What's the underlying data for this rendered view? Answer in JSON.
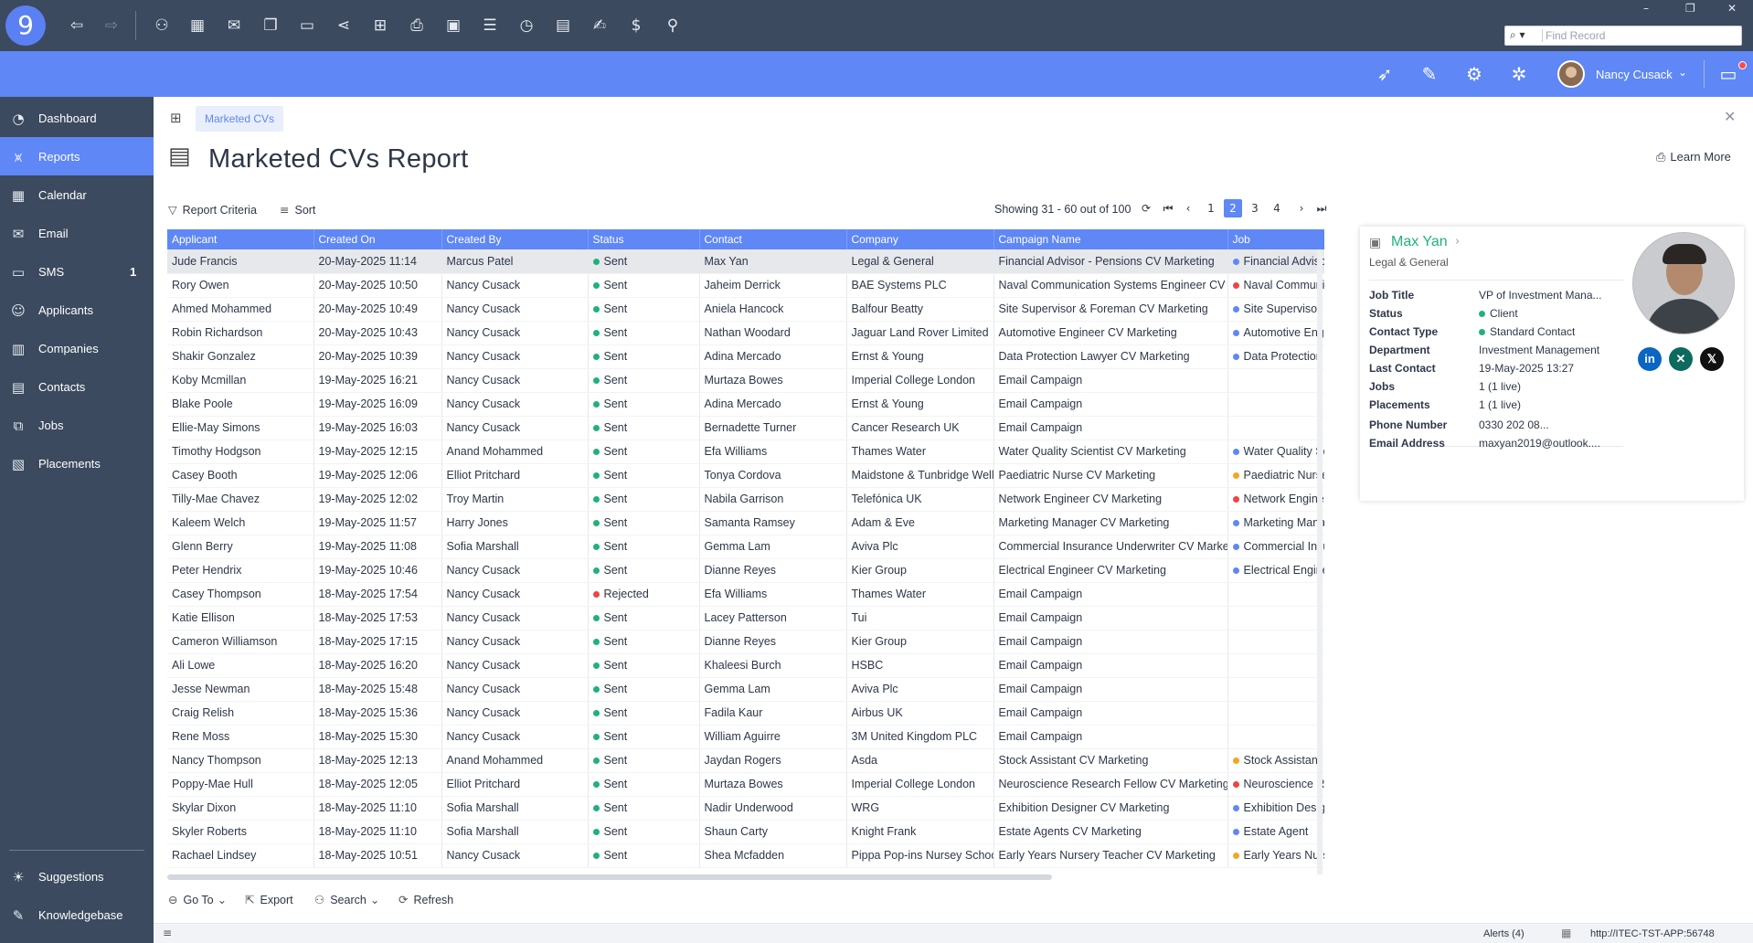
{
  "app": {
    "logo": "9"
  },
  "titlebar": {
    "search_placeholder": "Find Record",
    "window_controls": [
      "–",
      "❐",
      "✕"
    ]
  },
  "header": {
    "user_name": "Nancy Cusack"
  },
  "sidebar": {
    "items": [
      {
        "label": "Dashboard",
        "icon": "dashboard-icon"
      },
      {
        "label": "Reports",
        "icon": "reports-icon",
        "active": true
      },
      {
        "label": "Calendar",
        "icon": "calendar-icon"
      },
      {
        "label": "Email",
        "icon": "email-icon"
      },
      {
        "label": "SMS",
        "icon": "sms-icon",
        "count": "1"
      },
      {
        "label": "Applicants",
        "icon": "applicants-icon"
      },
      {
        "label": "Companies",
        "icon": "companies-icon"
      },
      {
        "label": "Contacts",
        "icon": "contacts-icon"
      },
      {
        "label": "Jobs",
        "icon": "jobs-icon"
      },
      {
        "label": "Placements",
        "icon": "placements-icon"
      }
    ],
    "bottom": [
      {
        "label": "Suggestions",
        "icon": "lightbulb-icon"
      },
      {
        "label": "Knowledgebase",
        "icon": "book-icon"
      }
    ]
  },
  "breadcrumb": {
    "tab": "Marketed CVs"
  },
  "page": {
    "title": "Marketed CVs Report",
    "learn_more": "Learn More"
  },
  "toolbar": {
    "report_criteria": "Report Criteria",
    "sort": "Sort",
    "showing": "Showing 31 - 60 out of 100",
    "pages": [
      "1",
      "2",
      "3",
      "4"
    ],
    "active_page": "2"
  },
  "table": {
    "columns": [
      "Applicant",
      "Created On",
      "Created By",
      "Status",
      "Contact",
      "Company",
      "Campaign Name",
      "Job"
    ],
    "rows": [
      [
        "Jude Francis",
        "20-May-2025 11:14",
        "Marcus Patel",
        "Sent",
        "Max Yan",
        "Legal & General",
        "Financial Advisor - Pensions CV Marketing",
        "Financial Advisor",
        "blue"
      ],
      [
        "Rory Owen",
        "20-May-2025 10:50",
        "Nancy Cusack",
        "Sent",
        "Jaheim Derrick",
        "BAE Systems PLC",
        "Naval Communication Systems Engineer CV",
        "Naval Communication",
        "red"
      ],
      [
        "Ahmed Mohammed",
        "20-May-2025 10:49",
        "Nancy Cusack",
        "Sent",
        "Aniela Hancock",
        "Balfour Beatty",
        "Site Supervisor & Foreman CV Marketing",
        "Site Supervisor",
        "blue"
      ],
      [
        "Robin Richardson",
        "20-May-2025 10:43",
        "Nancy Cusack",
        "Sent",
        "Nathan Woodard",
        "Jaguar Land Rover Limited",
        "Automotive Engineer CV Marketing",
        "Automotive Engineer",
        "blue"
      ],
      [
        "Shakir Gonzalez",
        "20-May-2025 10:39",
        "Nancy Cusack",
        "Sent",
        "Adina Mercado",
        "Ernst & Young",
        "Data Protection Lawyer CV Marketing",
        "Data Protection",
        "blue"
      ],
      [
        "Koby Mcmillan",
        "19-May-2025 16:21",
        "Nancy Cusack",
        "Sent",
        "Murtaza Bowes",
        "Imperial College London",
        "Email Campaign",
        "",
        ""
      ],
      [
        "Blake Poole",
        "19-May-2025 16:09",
        "Nancy Cusack",
        "Sent",
        "Adina Mercado",
        "Ernst & Young",
        "Email Campaign",
        "",
        ""
      ],
      [
        "Ellie-May Simons",
        "19-May-2025 16:03",
        "Nancy Cusack",
        "Sent",
        "Bernadette Turner",
        "Cancer Research UK",
        "Email Campaign",
        "",
        ""
      ],
      [
        "Timothy Hodgson",
        "19-May-2025 12:15",
        "Anand Mohammed",
        "Sent",
        "Efa Williams",
        "Thames Water",
        "Water Quality Scientist CV Marketing",
        "Water Quality Scientist",
        "blue"
      ],
      [
        "Casey Booth",
        "19-May-2025 12:06",
        "Elliot Pritchard",
        "Sent",
        "Tonya Cordova",
        "Maidstone & Tunbridge Wells",
        "Paediatric Nurse CV Marketing",
        "Paediatric Nurse",
        "orange"
      ],
      [
        "Tilly-Mae Chavez",
        "19-May-2025 12:02",
        "Troy Martin",
        "Sent",
        "Nabila Garrison",
        "Telefónica UK",
        "Network Engineer CV Marketing",
        "Network Engineer",
        "red"
      ],
      [
        "Kaleem Welch",
        "19-May-2025 11:57",
        "Harry Jones",
        "Sent",
        "Samanta Ramsey",
        "Adam & Eve",
        "Marketing Manager CV Marketing",
        "Marketing Manager",
        "blue"
      ],
      [
        "Glenn Berry",
        "19-May-2025 11:08",
        "Sofia Marshall",
        "Sent",
        "Gemma Lam",
        "Aviva Plc",
        "Commercial Insurance Underwriter CV Marketing",
        "Commercial Insurance",
        "blue"
      ],
      [
        "Peter Hendrix",
        "19-May-2025 10:46",
        "Nancy Cusack",
        "Sent",
        "Dianne Reyes",
        "Kier Group",
        "Electrical Engineer CV Marketing",
        "Electrical Engineer",
        "blue"
      ],
      [
        "Casey Thompson",
        "18-May-2025 17:54",
        "Nancy Cusack",
        "Rejected",
        "Efa Williams",
        "Thames Water",
        "Email Campaign",
        "",
        ""
      ],
      [
        "Katie Ellison",
        "18-May-2025 17:53",
        "Nancy Cusack",
        "Sent",
        "Lacey Patterson",
        "Tui",
        "Email Campaign",
        "",
        ""
      ],
      [
        "Cameron Williamson",
        "18-May-2025 17:15",
        "Nancy Cusack",
        "Sent",
        "Dianne Reyes",
        "Kier Group",
        "Email Campaign",
        "",
        ""
      ],
      [
        "Ali Lowe",
        "18-May-2025 16:20",
        "Nancy Cusack",
        "Sent",
        "Khaleesi Burch",
        "HSBC",
        "Email Campaign",
        "",
        ""
      ],
      [
        "Jesse Newman",
        "18-May-2025 15:48",
        "Nancy Cusack",
        "Sent",
        "Gemma Lam",
        "Aviva Plc",
        "Email Campaign",
        "",
        ""
      ],
      [
        "Craig Relish",
        "18-May-2025 15:36",
        "Nancy Cusack",
        "Sent",
        "Fadila Kaur",
        "Airbus UK",
        "Email Campaign",
        "",
        ""
      ],
      [
        "Rene Moss",
        "18-May-2025 15:30",
        "Nancy Cusack",
        "Sent",
        "William Aguirre",
        "3M United Kingdom PLC",
        "Email Campaign",
        "",
        ""
      ],
      [
        "Nancy Thompson",
        "18-May-2025 12:13",
        "Anand Mohammed",
        "Sent",
        "Jaydan Rogers",
        "Asda",
        "Stock Assistant CV Marketing",
        "Stock Assistant",
        "orange"
      ],
      [
        "Poppy-Mae Hull",
        "18-May-2025 12:05",
        "Elliot Pritchard",
        "Sent",
        "Murtaza Bowes",
        "Imperial College London",
        "Neuroscience Research Fellow CV Marketing",
        "Neuroscience Research",
        "red"
      ],
      [
        "Skylar Dixon",
        "18-May-2025 11:10",
        "Sofia Marshall",
        "Sent",
        "Nadir Underwood",
        "WRG",
        "Exhibition Designer CV Marketing",
        "Exhibition Designer",
        "blue"
      ],
      [
        "Skyler Roberts",
        "18-May-2025 11:10",
        "Sofia Marshall",
        "Sent",
        "Shaun Carty",
        "Knight Frank",
        "Estate Agents CV Marketing",
        "Estate Agent",
        "blue"
      ],
      [
        "Rachael Lindsey",
        "18-May-2025 10:51",
        "Nancy Cusack",
        "Sent",
        "Shea Mcfadden",
        "Pippa Pop-ins Nursey School",
        "Early Years Nursery Teacher CV Marketing",
        "Early Years Nursery",
        "orange"
      ]
    ]
  },
  "bottom_toolbar": {
    "goto": "Go To",
    "export": "Export",
    "search": "Search",
    "refresh": "Refresh"
  },
  "statusbar": {
    "alerts": "Alerts (4)",
    "server": "http://ITEC-TST-APP:56748"
  },
  "card": {
    "name": "Max Yan",
    "company": "Legal & General",
    "fields": [
      {
        "key": "Job Title",
        "value": "VP of Investment Mana..."
      },
      {
        "key": "Status",
        "value": "Client",
        "dot": "green"
      },
      {
        "key": "Contact Type",
        "value": "Standard Contact",
        "dot": "green"
      },
      {
        "key": "Department",
        "value": "Investment Management"
      },
      {
        "key": "Last Contact",
        "value": "19-May-2025 13:27"
      },
      {
        "key": "Jobs",
        "value": "1 (1 live)"
      },
      {
        "key": "Placements",
        "value": "1 (1 live)"
      }
    ],
    "contact_fields": [
      {
        "key": "Phone Number",
        "value": "0330 202 08..."
      },
      {
        "key": "Email Address",
        "value": "maxyan2019@outlook...."
      }
    ],
    "social": [
      "in",
      "✕",
      "𝕏"
    ]
  }
}
